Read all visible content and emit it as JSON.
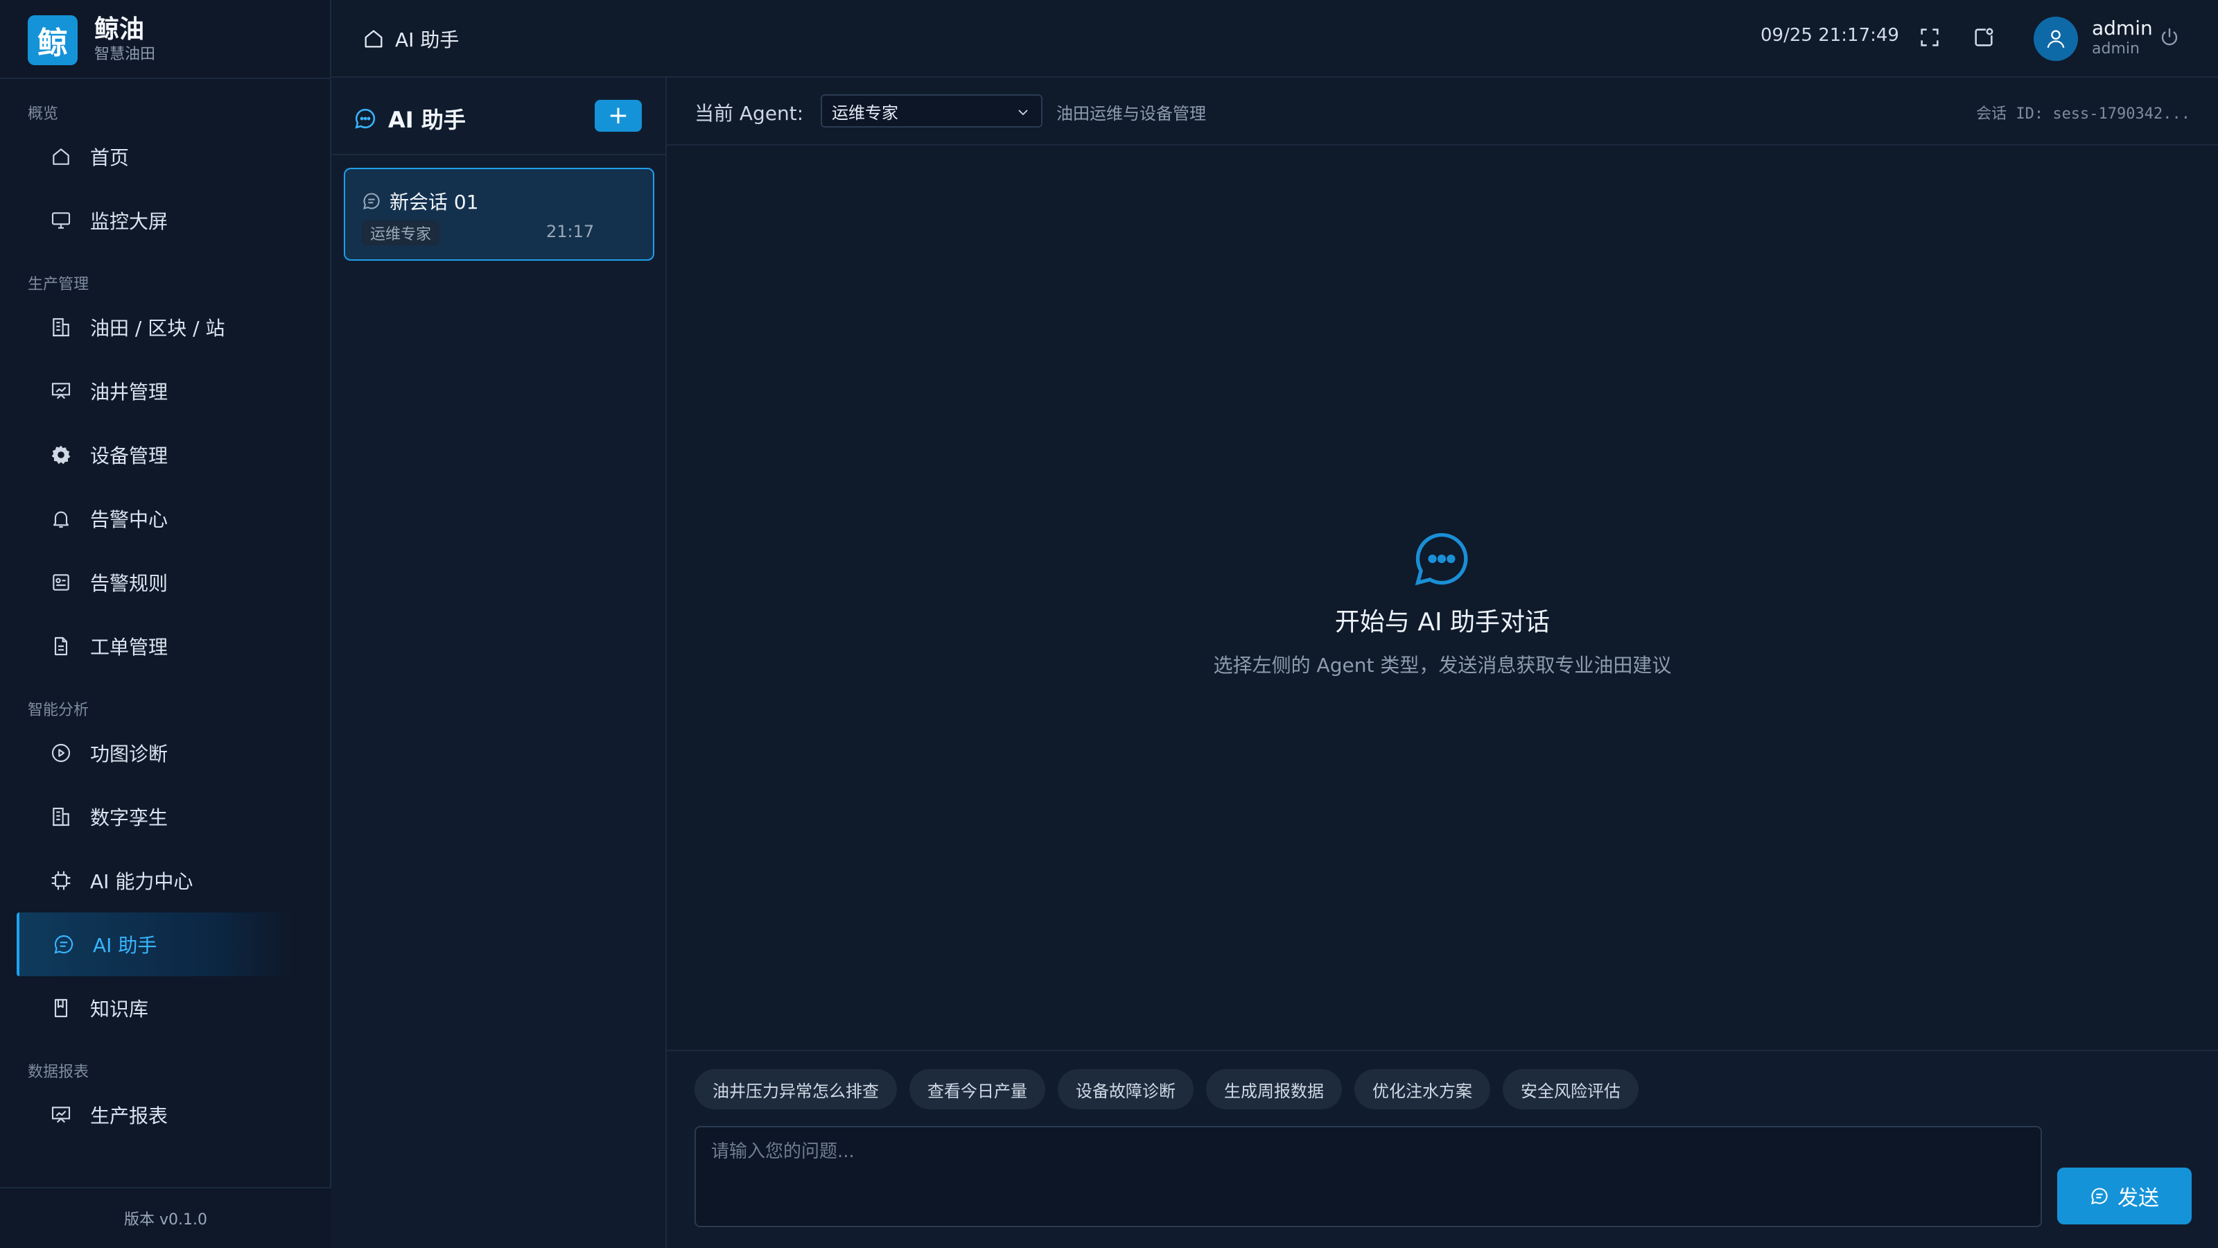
{
  "brand": {
    "logo_char": "鲸",
    "name": "鲸油",
    "subtitle": "智慧油田"
  },
  "sidebar": {
    "groups": [
      {
        "title": "概览",
        "items": [
          {
            "label": "首页",
            "icon": "home-icon"
          },
          {
            "label": "监控大屏",
            "icon": "monitor-icon"
          }
        ]
      },
      {
        "title": "生产管理",
        "items": [
          {
            "label": "油田 / 区块 / 站",
            "icon": "building-icon"
          },
          {
            "label": "油井管理",
            "icon": "presentation-icon"
          },
          {
            "label": "设备管理",
            "icon": "gear-icon"
          },
          {
            "label": "告警中心",
            "icon": "bell-icon"
          },
          {
            "label": "告警规则",
            "icon": "rules-icon"
          },
          {
            "label": "工单管理",
            "icon": "document-icon"
          }
        ]
      },
      {
        "title": "智能分析",
        "items": [
          {
            "label": "功图诊断",
            "icon": "play-circle-icon"
          },
          {
            "label": "数字孪生",
            "icon": "building-icon"
          },
          {
            "label": "AI 能力中心",
            "icon": "chip-icon"
          },
          {
            "label": "AI 助手",
            "icon": "chat-icon",
            "active": true
          },
          {
            "label": "知识库",
            "icon": "book-icon"
          }
        ]
      },
      {
        "title": "数据报表",
        "items": [
          {
            "label": "生产报表",
            "icon": "presentation-icon"
          }
        ]
      }
    ],
    "version": "版本 v0.1.0"
  },
  "header": {
    "breadcrumb": "AI 助手",
    "datetime": "09/25 21:17:49",
    "user_name": "admin",
    "user_role": "admin"
  },
  "session_panel": {
    "title": "AI 助手",
    "add_label": "+",
    "sessions": [
      {
        "title": "新会话 01",
        "tag": "运维专家",
        "time": "21:17",
        "active": true
      }
    ]
  },
  "chat": {
    "agent_label": "当前 Agent:",
    "agent_selected": "运维专家",
    "agent_desc": "油田运维与设备管理",
    "session_id": "会话 ID: sess-1790342...",
    "empty_title": "开始与 AI 助手对话",
    "empty_subtitle": "选择左侧的 Agent 类型，发送消息获取专业油田建议",
    "quick_prompts": [
      "油井压力异常怎么排查",
      "查看今日产量",
      "设备故障诊断",
      "生成周报数据",
      "优化注水方案",
      "安全风险评估"
    ],
    "input_placeholder": "请输入您的问题...",
    "send_label": "发送"
  },
  "colors": {
    "accent": "#1593d8",
    "active_text": "#39b5ff",
    "background": "#0f1a2b",
    "sidebar_bg": "#0e1828"
  }
}
